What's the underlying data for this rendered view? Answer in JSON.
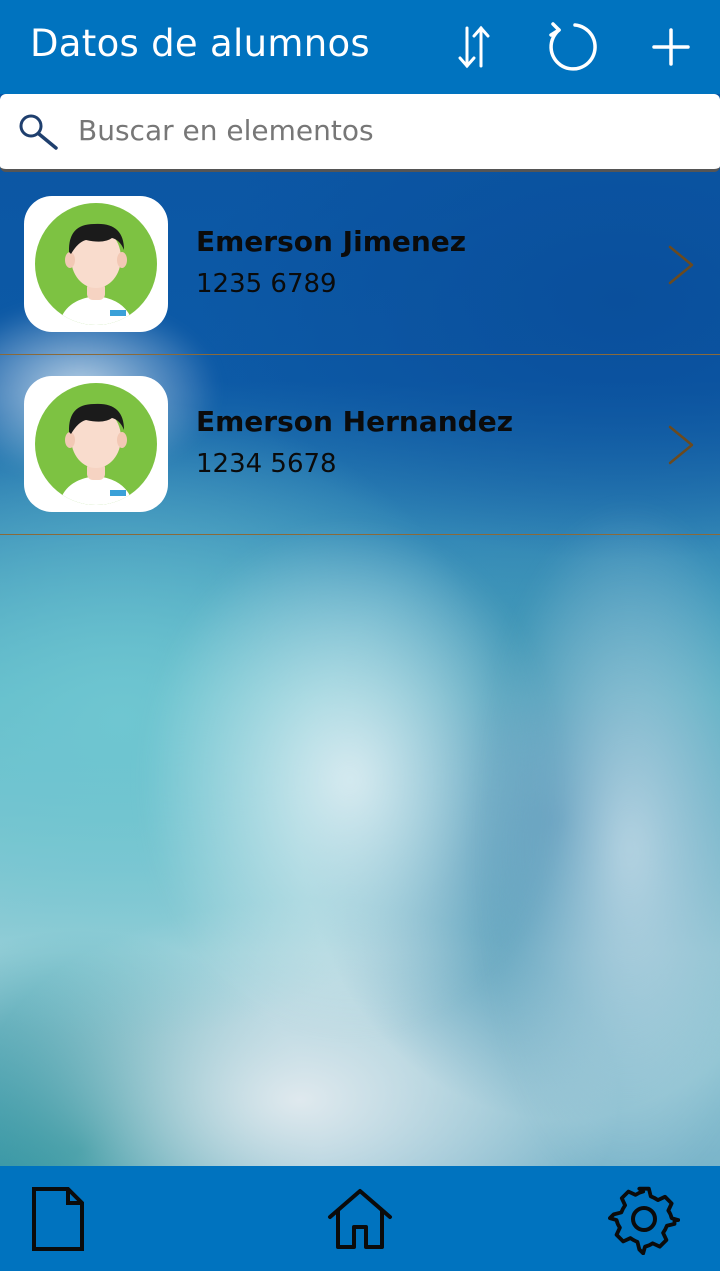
{
  "header": {
    "title": "Datos de alumnos",
    "icons": [
      "sort-icon",
      "refresh-icon",
      "add-icon"
    ]
  },
  "search": {
    "placeholder": "Buscar en elementos",
    "value": "",
    "icon": "search-icon"
  },
  "students": [
    {
      "name": "Emerson Jimenez",
      "phone": "1235 6789",
      "avatar_icon": "student-avatar"
    },
    {
      "name": "Emerson Hernandez",
      "phone": "1234 5678",
      "avatar_icon": "student-avatar"
    }
  ],
  "footer": {
    "icons": [
      "document-icon",
      "home-icon",
      "settings-icon"
    ]
  },
  "colors": {
    "accent": "#0073bf",
    "row_divider": "#8a6a3a",
    "avatar_green": "#7dc242",
    "chevron": "#6b4a1e"
  }
}
